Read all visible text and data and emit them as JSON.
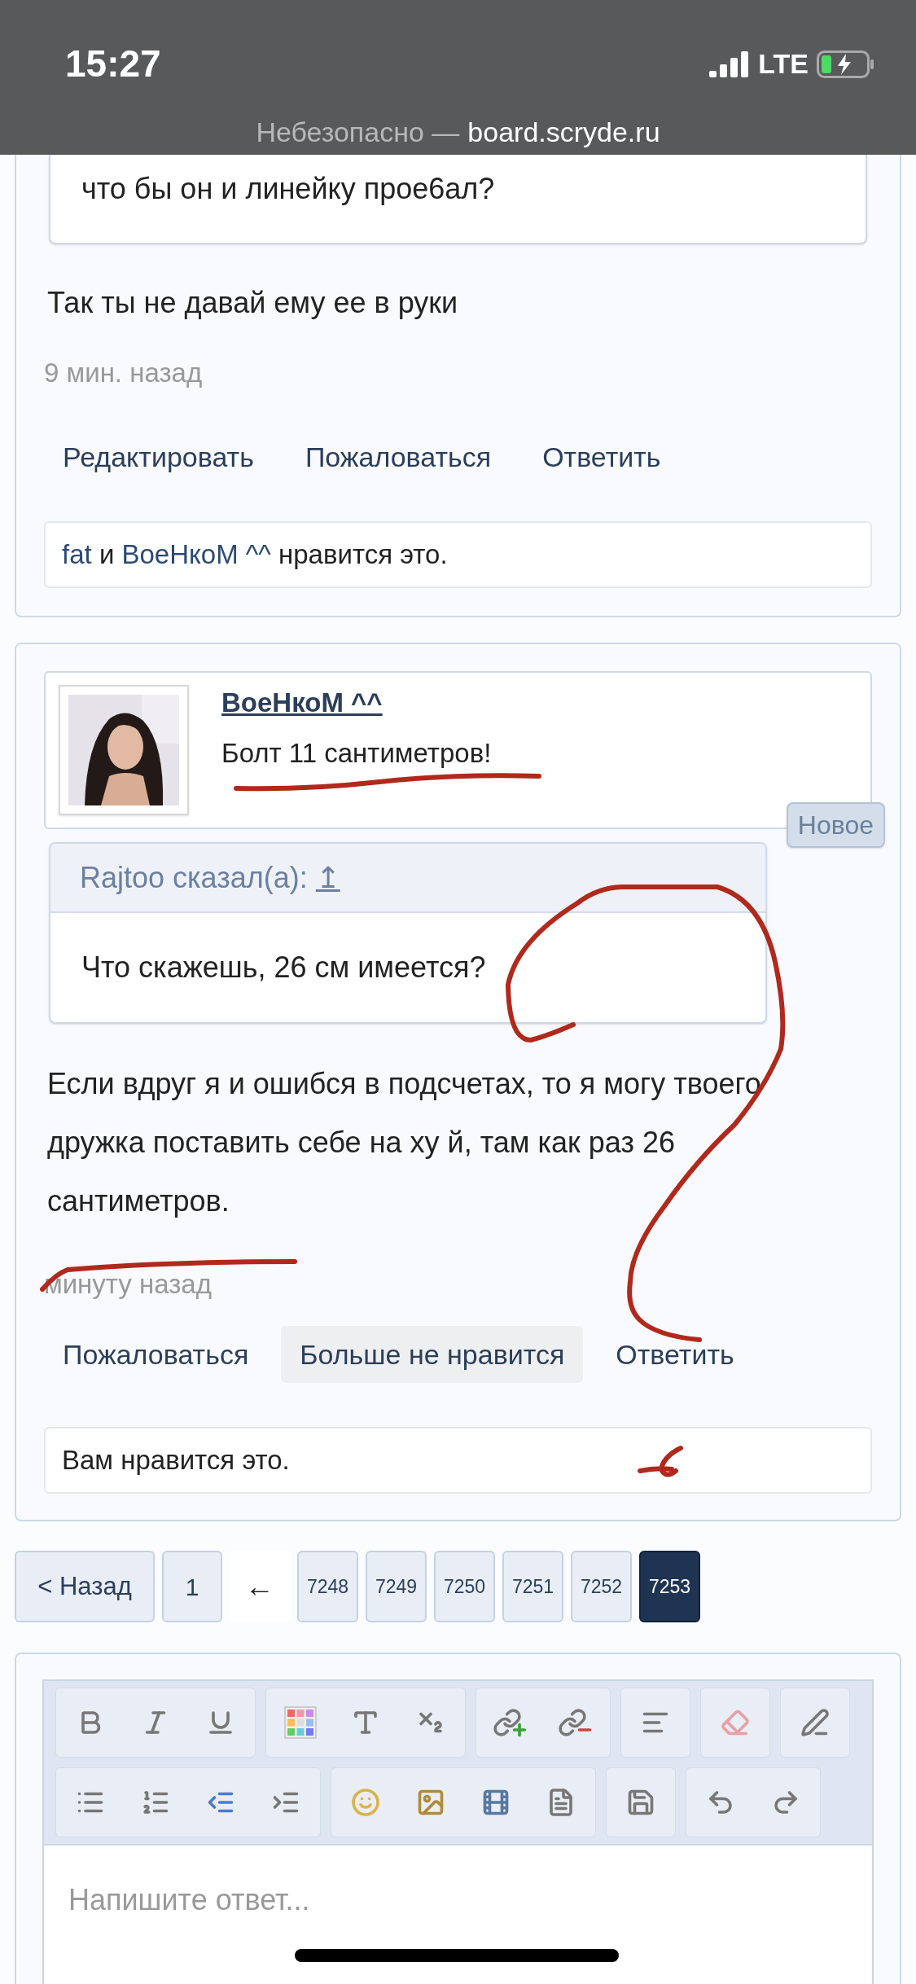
{
  "status_bar": {
    "time": "15:27",
    "network": "LTE"
  },
  "address_bar": {
    "security": "Небезопасно —",
    "domain": "board.scryde.ru"
  },
  "posts": [
    {
      "kind": "cut",
      "quote": {
        "text": "что бы он и линейку прое6ал?"
      },
      "text": "Так ты не давай ему ее в руки",
      "time": "9 мин. назад",
      "actions": [
        {
          "label": "Редактировать",
          "active": false
        },
        {
          "label": "Пожаловаться",
          "active": false
        },
        {
          "label": "Ответить",
          "active": false
        }
      ],
      "likes": [
        {
          "kind": "link",
          "text": "fat"
        },
        {
          "kind": "plain",
          "text": "и"
        },
        {
          "kind": "link",
          "text": "ВоеНкоМ ^^"
        },
        {
          "kind": "plain",
          "text": "нравится это."
        }
      ]
    },
    {
      "kind": "full",
      "author": {
        "name": "ВоеНкоМ ^^",
        "message": "Болт 11 сантиметров!"
      },
      "badge": "Новое",
      "quote": {
        "author": "Rajtoo сказал(а):",
        "jump": "↥",
        "text": "Что скажешь, 26 см имеется?"
      },
      "text": "Если вдруг я и ошибся в подсчетах, то я могу твоего дружка поставить себе на ху й, там как раз 26 сантиметров.",
      "time": "минуту назад",
      "actions": [
        {
          "label": "Пожаловаться",
          "active": false
        },
        {
          "label": "Больше не нравится",
          "active": true
        },
        {
          "label": "Ответить",
          "active": false
        }
      ],
      "likes": [
        {
          "kind": "plain",
          "text": "Вам нравится это."
        }
      ]
    }
  ],
  "pagination": [
    {
      "kind": "prev",
      "label": "< Назад",
      "selected": false
    },
    {
      "kind": "page",
      "label": "1",
      "selected": false
    },
    {
      "kind": "jump",
      "label": "←",
      "selected": false
    },
    {
      "kind": "page",
      "label": "7248",
      "selected": false
    },
    {
      "kind": "page",
      "label": "7249",
      "selected": false
    },
    {
      "kind": "page",
      "label": "7250",
      "selected": false
    },
    {
      "kind": "page",
      "label": "7251",
      "selected": false
    },
    {
      "kind": "page",
      "label": "7252",
      "selected": false
    },
    {
      "kind": "page",
      "label": "7253",
      "selected": true
    }
  ],
  "editor": {
    "placeholder": "Напишите ответ..."
  }
}
